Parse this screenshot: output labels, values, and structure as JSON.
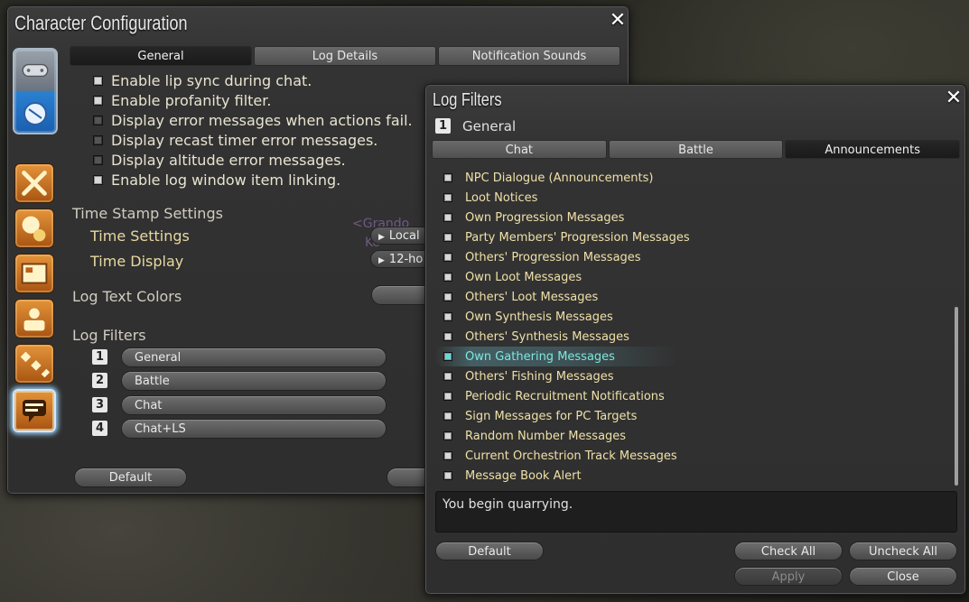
{
  "char_config": {
    "title": "Character Configuration",
    "tabs": [
      "General",
      "Log Details",
      "Notification Sounds"
    ],
    "options": [
      {
        "label": "Enable lip sync during chat.",
        "checked": true
      },
      {
        "label": "Enable profanity filter.",
        "checked": true
      },
      {
        "label": "Display error messages when actions fail.",
        "checked": false
      },
      {
        "label": "Display recast timer error messages.",
        "checked": false
      },
      {
        "label": "Display altitude error messages.",
        "checked": false
      },
      {
        "label": "Enable log window item linking.",
        "checked": true
      }
    ],
    "timestamp": {
      "heading": "Time Stamp Settings",
      "time_settings_label": "Time Settings",
      "time_settings_value": "Local",
      "time_display_label": "Time Display",
      "time_display_value": "12-ho"
    },
    "log_text_colors": "Log Text Colors",
    "log_filters": {
      "heading": "Log Filters",
      "items": [
        {
          "num": "1",
          "label": "General"
        },
        {
          "num": "2",
          "label": "Battle"
        },
        {
          "num": "3",
          "label": "Chat"
        },
        {
          "num": "4",
          "label": "Chat+LS"
        }
      ]
    },
    "ghost_text": [
      "<Grando",
      "Ko"
    ],
    "default_button": "Default"
  },
  "log_filters_window": {
    "title": "Log Filters",
    "subtitle_num": "1",
    "subtitle": "General",
    "tabs": [
      "Chat",
      "Battle",
      "Announcements"
    ],
    "active_tab": "Announcements",
    "items": [
      {
        "label": "NPC Dialogue (Announcements)",
        "highlight": false
      },
      {
        "label": "Loot Notices",
        "highlight": false
      },
      {
        "label": "Own Progression Messages",
        "highlight": false
      },
      {
        "label": "Party Members' Progression Messages",
        "highlight": false
      },
      {
        "label": "Others' Progression Messages",
        "highlight": false
      },
      {
        "label": "Own Loot Messages",
        "highlight": false
      },
      {
        "label": "Others' Loot Messages",
        "highlight": false
      },
      {
        "label": "Own Synthesis Messages",
        "highlight": false
      },
      {
        "label": "Others' Synthesis Messages",
        "highlight": false
      },
      {
        "label": "Own Gathering Messages",
        "highlight": true
      },
      {
        "label": "Others' Fishing Messages",
        "highlight": false
      },
      {
        "label": "Periodic Recruitment Notifications",
        "highlight": false
      },
      {
        "label": "Sign Messages for PC Targets",
        "highlight": false
      },
      {
        "label": "Random Number Messages",
        "highlight": false
      },
      {
        "label": "Current Orchestrion Track Messages",
        "highlight": false
      },
      {
        "label": "Message Book Alert",
        "highlight": false
      }
    ],
    "preview_text": "You begin quarrying.",
    "buttons": {
      "default": "Default",
      "check_all": "Check All",
      "uncheck_all": "Uncheck All",
      "apply": "Apply",
      "close": "Close"
    }
  },
  "colors": {
    "highlight_text": "#7fe6e0",
    "item_text": "#efe0a8"
  }
}
